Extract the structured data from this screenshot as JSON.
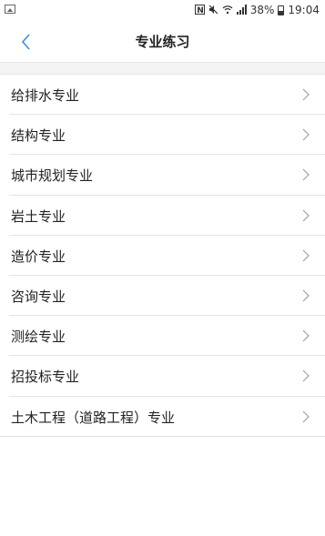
{
  "status_bar": {
    "battery_percent": "38%",
    "time": "19:04",
    "icons": [
      "nfc-icon",
      "mute-icon",
      "wifi-icon",
      "signal-icon",
      "battery-icon"
    ]
  },
  "header": {
    "title": "专业练习",
    "back_icon": "chevron-left-icon",
    "accent_color": "#3a8fd8"
  },
  "list": {
    "items": [
      {
        "label": "给排水专业"
      },
      {
        "label": "结构专业"
      },
      {
        "label": "城市规划专业"
      },
      {
        "label": "岩土专业"
      },
      {
        "label": "造价专业"
      },
      {
        "label": "咨询专业"
      },
      {
        "label": "测绘专业"
      },
      {
        "label": "招投标专业"
      },
      {
        "label": "土木工程（道路工程）专业"
      }
    ],
    "row_icon": "chevron-right-icon"
  }
}
